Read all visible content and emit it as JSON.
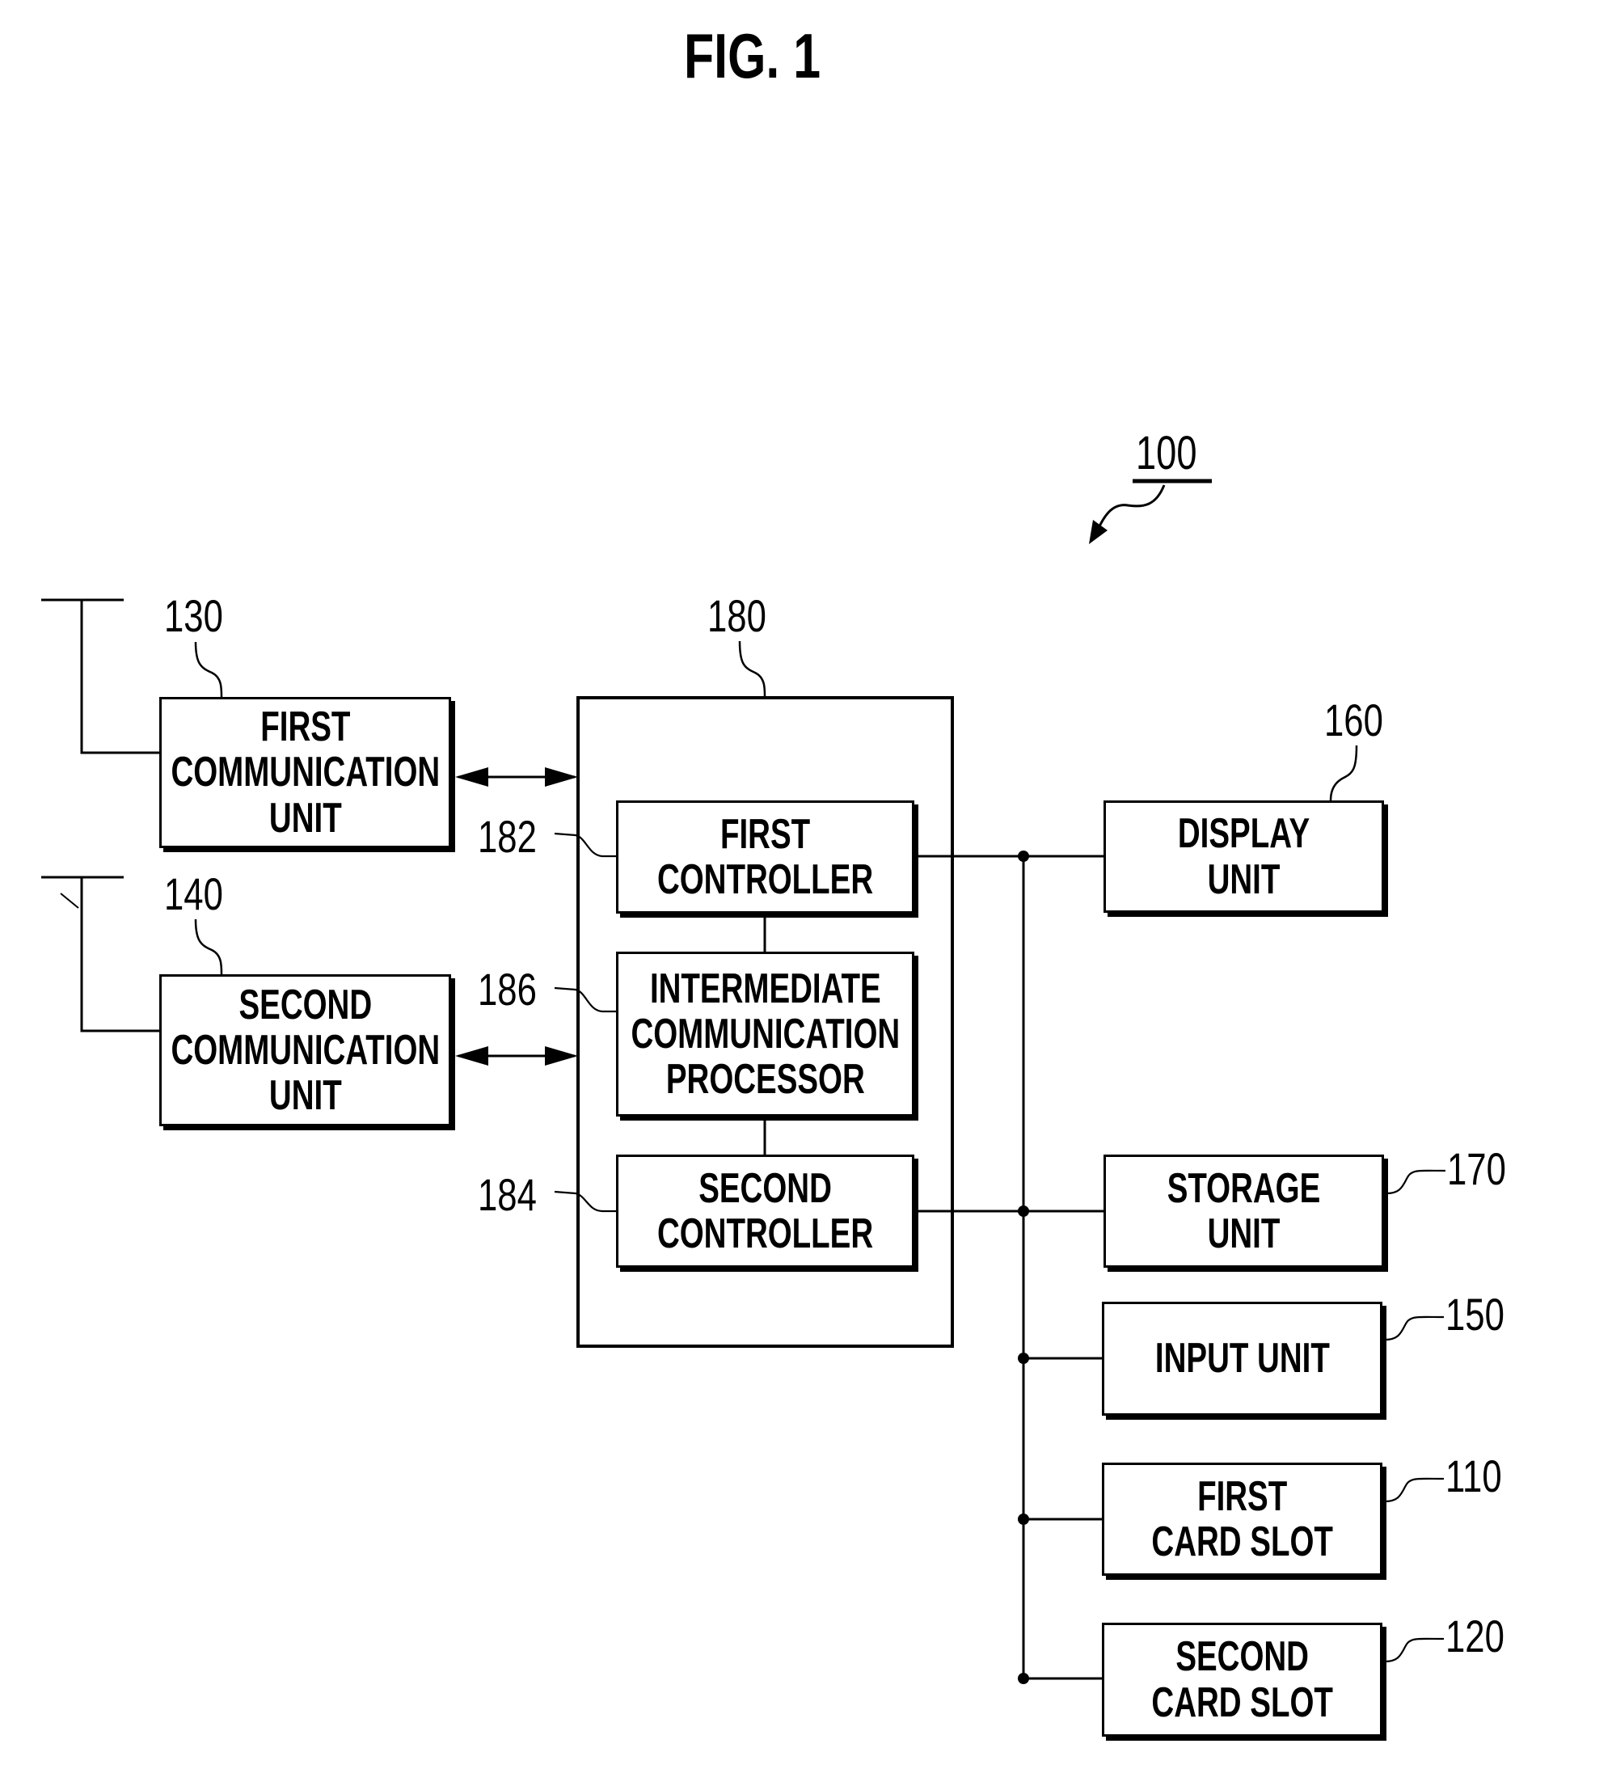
{
  "figure": {
    "title": "FIG. 1",
    "device_ref": "100"
  },
  "blocks": {
    "first_comm": {
      "ref": "130",
      "label": "FIRST\nCOMMUNICATION\nUNIT"
    },
    "second_comm": {
      "ref": "140",
      "label": "SECOND\nCOMMUNICATION\nUNIT"
    },
    "controller_group": {
      "ref": "180"
    },
    "first_controller": {
      "ref": "182",
      "label": "FIRST\nCONTROLLER"
    },
    "intermediate": {
      "ref": "186",
      "label": "INTERMEDIATE\nCOMMUNICATION\nPROCESSOR"
    },
    "second_controller": {
      "ref": "184",
      "label": "SECOND\nCONTROLLER"
    },
    "display": {
      "ref": "160",
      "label": "DISPLAY UNIT"
    },
    "storage": {
      "ref": "170",
      "label": "STORAGE UNIT"
    },
    "input": {
      "ref": "150",
      "label": "INPUT UNIT"
    },
    "first_card_slot": {
      "ref": "110",
      "label": "FIRST\nCARD SLOT"
    },
    "second_card_slot": {
      "ref": "120",
      "label": "SECOND\nCARD SLOT"
    }
  },
  "connections": [
    {
      "from": "first_comm",
      "to": "controller_group",
      "type": "bidirectional-arrow"
    },
    {
      "from": "second_comm",
      "to": "controller_group",
      "type": "bidirectional-arrow"
    },
    {
      "from": "first_controller",
      "to": "intermediate",
      "type": "line"
    },
    {
      "from": "intermediate",
      "to": "second_controller",
      "type": "line"
    },
    {
      "from": "first_controller",
      "to": "bus",
      "type": "line"
    },
    {
      "from": "second_controller",
      "to": "bus",
      "type": "line"
    },
    {
      "from": "bus",
      "to": "display",
      "type": "line"
    },
    {
      "from": "bus",
      "to": "storage",
      "type": "line"
    },
    {
      "from": "bus",
      "to": "input",
      "type": "line"
    },
    {
      "from": "bus",
      "to": "first_card_slot",
      "type": "line"
    },
    {
      "from": "bus",
      "to": "second_card_slot",
      "type": "line"
    }
  ]
}
